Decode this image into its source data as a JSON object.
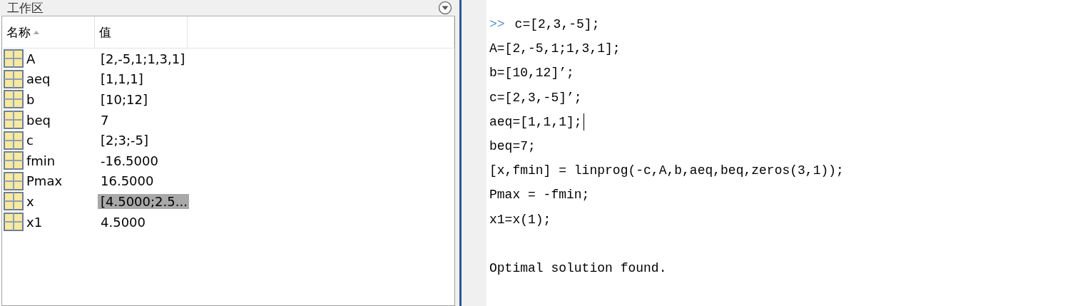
{
  "workspace": {
    "title": "工作区",
    "columns": [
      {
        "label": "名称",
        "sorted": true
      },
      {
        "label": "值",
        "sorted": false
      }
    ],
    "rows": [
      {
        "name": "A",
        "value": "[2,-5,1;1,3,1]",
        "selected": false
      },
      {
        "name": "aeq",
        "value": "[1,1,1]",
        "selected": false
      },
      {
        "name": "b",
        "value": "[10;12]",
        "selected": false
      },
      {
        "name": "beq",
        "value": "7",
        "selected": false
      },
      {
        "name": "c",
        "value": "[2;3;-5]",
        "selected": false
      },
      {
        "name": "fmin",
        "value": "-16.5000",
        "selected": false
      },
      {
        "name": "Pmax",
        "value": "16.5000",
        "selected": false
      },
      {
        "name": "x",
        "value": "[4.5000;2.5...",
        "selected": true
      },
      {
        "name": "x1",
        "value": "4.5000",
        "selected": false
      }
    ]
  },
  "console": {
    "prompt": ">>",
    "lines": [
      {
        "text": "c=[2,3,-5];",
        "cursor": false
      },
      {
        "text": "A=[2,-5,1;1,3,1];",
        "cursor": false
      },
      {
        "text": "b=[10,12]’;",
        "cursor": false
      },
      {
        "text": "c=[2,3,-5]’;",
        "cursor": false
      },
      {
        "text": "aeq=[1,1,1];",
        "cursor": true
      },
      {
        "text": "beq=7;",
        "cursor": false
      },
      {
        "text": "[x,fmin] = linprog(-c,A,b,aeq,beq,zeros(3,1));",
        "cursor": false
      },
      {
        "text": "Pmax = -fmin;",
        "cursor": false
      },
      {
        "text": "x1=x(1);",
        "cursor": false
      }
    ],
    "output": "Optimal solution found."
  }
}
